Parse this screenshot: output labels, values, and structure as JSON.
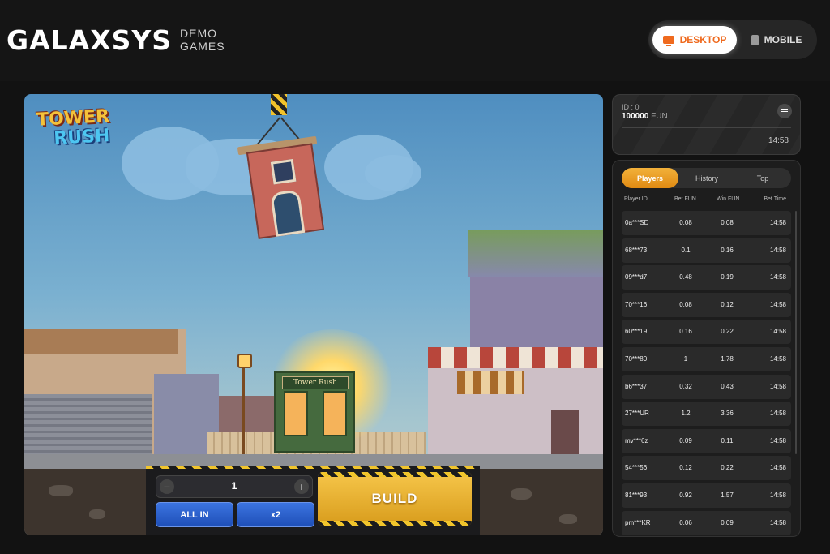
{
  "header": {
    "brand": "GALAXSYS",
    "demo_line1": "DEMO",
    "demo_line2": "GAMES",
    "view_toggle": {
      "desktop_label": "DESKTOP",
      "mobile_label": "MOBILE",
      "selected": "desktop"
    }
  },
  "game": {
    "logo_line1": "TOWER",
    "logo_line2": "RUSH",
    "shop_sign": "Tower Rush",
    "controls": {
      "bet_value": "1",
      "minus": "−",
      "plus": "+",
      "all_in_label": "ALL IN",
      "double_label": "x2",
      "build_label": "BUILD"
    }
  },
  "account": {
    "id_text": "ID : 0",
    "balance": "100000",
    "currency": "FUN",
    "time": "14:58"
  },
  "bets_panel": {
    "tabs": [
      "Players",
      "History",
      "Top"
    ],
    "active_tab": "Players",
    "columns": [
      "Player ID",
      "Bet  FUN",
      "Win  FUN",
      "Bet Time"
    ],
    "rows": [
      {
        "player": "0a***SD",
        "bet": "0.08",
        "win": "0.08",
        "time": "14:58"
      },
      {
        "player": "68***73",
        "bet": "0.1",
        "win": "0.16",
        "time": "14:58"
      },
      {
        "player": "09***d7",
        "bet": "0.48",
        "win": "0.19",
        "time": "14:58"
      },
      {
        "player": "70***16",
        "bet": "0.08",
        "win": "0.12",
        "time": "14:58"
      },
      {
        "player": "60***19",
        "bet": "0.16",
        "win": "0.22",
        "time": "14:58"
      },
      {
        "player": "70***80",
        "bet": "1",
        "win": "1.78",
        "time": "14:58"
      },
      {
        "player": "b6***37",
        "bet": "0.32",
        "win": "0.43",
        "time": "14:58"
      },
      {
        "player": "27***UR",
        "bet": "1.2",
        "win": "3.36",
        "time": "14:58"
      },
      {
        "player": "mv***6z",
        "bet": "0.09",
        "win": "0.11",
        "time": "14:58"
      },
      {
        "player": "54***56",
        "bet": "0.12",
        "win": "0.22",
        "time": "14:58"
      },
      {
        "player": "81***93",
        "bet": "0.92",
        "win": "1.57",
        "time": "14:58"
      },
      {
        "player": "pm***KR",
        "bet": "0.06",
        "win": "0.09",
        "time": "14:58"
      }
    ]
  },
  "colors": {
    "accent": "#ef6a1e",
    "tab_active": "#f2a62a",
    "button_blue": "#2a5fcf",
    "build_gold": "#f0b834"
  }
}
